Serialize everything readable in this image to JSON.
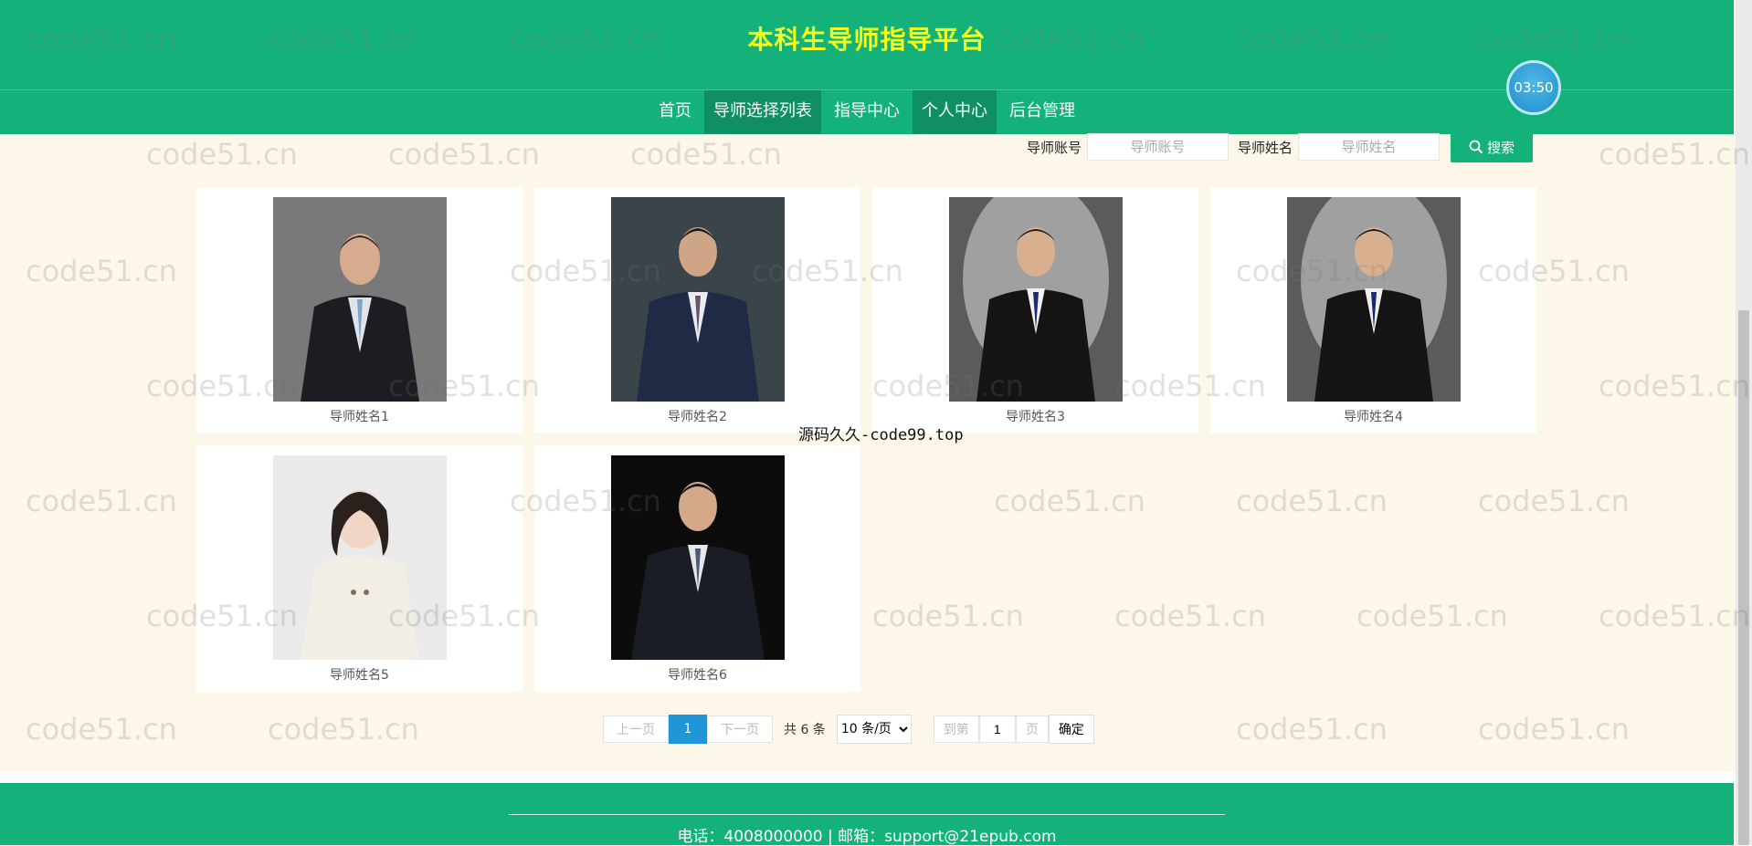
{
  "header": {
    "title": "本科生导师指导平台",
    "nav": [
      {
        "label": "首页"
      },
      {
        "label": "导师选择列表"
      },
      {
        "label": "指导中心"
      },
      {
        "label": "个人中心"
      },
      {
        "label": "后台管理"
      }
    ],
    "timer": "03:50"
  },
  "search": {
    "account_label": "导师账号",
    "account_placeholder": "导师账号",
    "name_label": "导师姓名",
    "name_placeholder": "导师姓名",
    "button_label": "搜索"
  },
  "tutors": [
    {
      "name": "导师姓名1"
    },
    {
      "name": "导师姓名2"
    },
    {
      "name": "导师姓名3"
    },
    {
      "name": "导师姓名4"
    },
    {
      "name": "导师姓名5"
    },
    {
      "name": "导师姓名6"
    }
  ],
  "overlay_text": "源码久久-code99.top",
  "pagination": {
    "prev": "上一页",
    "current": "1",
    "next": "下一页",
    "total": "共 6 条",
    "page_size": "10 条/页",
    "goto_prefix": "到第",
    "goto_value": "1",
    "goto_suffix": "页",
    "confirm": "确定"
  },
  "footer": {
    "contact": "电话：4008000000 | 邮箱：support@21epub.com"
  },
  "watermark": "code51.cn",
  "colors": {
    "primary": "#14b27a",
    "title": "#f5ff1a",
    "page_bg": "#fdf7ea",
    "pager_active": "#2196d6"
  }
}
